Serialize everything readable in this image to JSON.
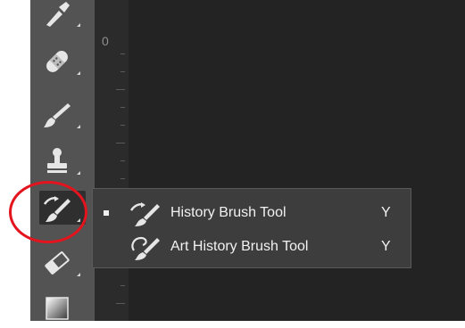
{
  "toolbar": {
    "tools": [
      {
        "icon": "eyedropper-icon"
      },
      {
        "icon": "healing-brush-icon"
      },
      {
        "icon": "brush-icon"
      },
      {
        "icon": "clone-stamp-icon"
      },
      {
        "icon": "history-brush-icon",
        "active": true
      },
      {
        "icon": "eraser-icon"
      },
      {
        "icon": "gradient-icon"
      }
    ]
  },
  "ruler": {
    "zero_label": "0"
  },
  "flyout": {
    "items": [
      {
        "label": "History Brush Tool",
        "shortcut": "Y",
        "icon": "history-brush-icon",
        "selected": true
      },
      {
        "label": "Art History Brush Tool",
        "shortcut": "Y",
        "icon": "art-history-brush-icon",
        "selected": false
      }
    ]
  },
  "colors": {
    "toolbar_bg": "#535353",
    "canvas_bg": "#232323",
    "flyout_bg": "#3d3d3d",
    "highlight": "#e3141d"
  }
}
